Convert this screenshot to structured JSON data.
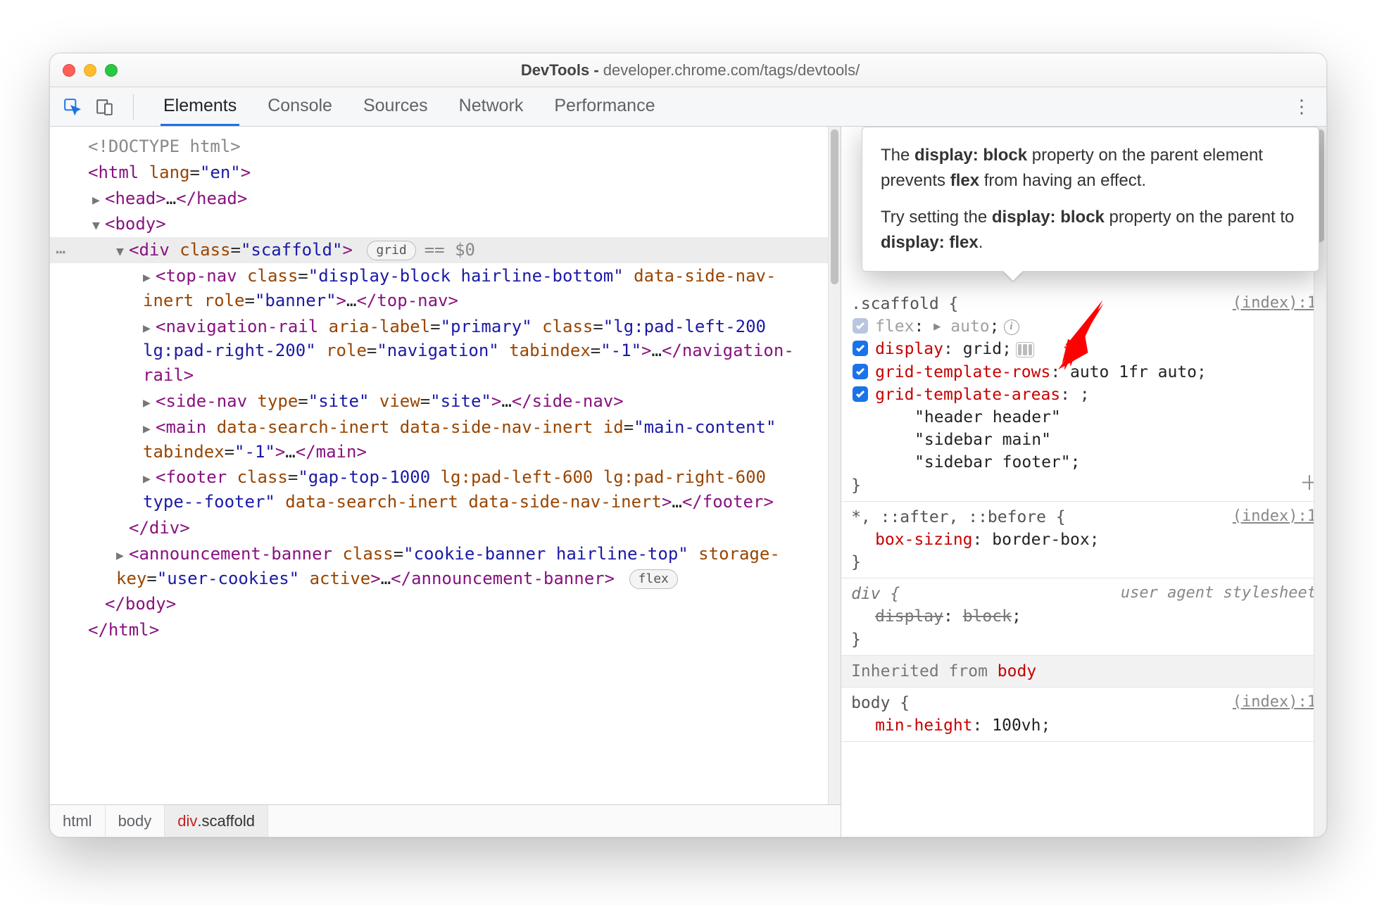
{
  "title_prefix": "DevTools - ",
  "title_url": "developer.chrome.com/tags/devtools/",
  "tabs": [
    "Elements",
    "Console",
    "Sources",
    "Network",
    "Performance"
  ],
  "tabs_active_index": 0,
  "dom": {
    "doctype": "<!DOCTYPE html>",
    "html_open": "<html lang=\"en\">",
    "head": "<head>…</head>",
    "body_open": "<body>",
    "scaffold_open": "<div class=\"scaffold\">",
    "scaffold_badge": "grid",
    "eq0": "== $0",
    "topnav": "<top-nav class=\"display-block hairline-bottom\" data-side-nav-inert role=\"banner\">…</top-nav>",
    "navrail": "<navigation-rail aria-label=\"primary\" class=\"lg:pad-left-200 lg:pad-right-200\" role=\"navigation\" tabindex=\"-1\">…</navigation-rail>",
    "sidenav": "<side-nav type=\"site\" view=\"site\">…</side-nav>",
    "main": "<main data-search-inert data-side-nav-inert id=\"main-content\" tabindex=\"-1\">…</main>",
    "footer": "<footer class=\"gap-top-1000 lg:pad-left-600 lg:pad-right-600 type--footer\" data-search-inert data-side-nav-inert>…</footer>",
    "div_close": "</div>",
    "announcement": "<announcement-banner class=\"cookie-banner hairline-top\" storage-key=\"user-cookies\" active>…</announcement-banner>",
    "announcement_badge": "flex",
    "body_close": "</body>",
    "html_close": "</html>"
  },
  "breadcrumbs": [
    {
      "label": "html",
      "active": false
    },
    {
      "label": "body",
      "active": false
    },
    {
      "label": "div.scaffold",
      "active": true
    }
  ],
  "tooltip": {
    "p1_pre": "The ",
    "p1_b1": "display: block",
    "p1_mid": " property on the parent element prevents ",
    "p1_b2": "flex",
    "p1_post": " from having an effect.",
    "p2_pre": "Try setting the ",
    "p2_b1": "display: block",
    "p2_mid": " property on the parent to ",
    "p2_b2": "display: flex",
    "p2_post": "."
  },
  "styles": {
    "rule1": {
      "selector": ".scaffold {",
      "source": "(index):1",
      "decls": [
        {
          "prop": "flex",
          "val": "auto",
          "checked": false,
          "inactive": true,
          "expand": true,
          "info": true
        },
        {
          "prop": "display",
          "val": "grid",
          "checked": true,
          "gridchip": true
        },
        {
          "prop": "grid-template-rows",
          "val": "auto 1fr auto",
          "checked": true
        },
        {
          "prop": "grid-template-areas",
          "val": "",
          "checked": true
        }
      ],
      "area_lines": [
        "\"header header\"",
        "\"sidebar main\"",
        "\"sidebar footer\""
      ],
      "close_brace": "}"
    },
    "rule2": {
      "selector": "*, ::after, ::before {",
      "source": "(index):1",
      "decls": [
        {
          "prop": "box-sizing",
          "val": "border-box"
        }
      ],
      "close_brace": "}"
    },
    "rule3": {
      "selector": "div {",
      "source": "user agent stylesheet",
      "decls": [
        {
          "prop": "display",
          "val": "block",
          "strike": true
        }
      ],
      "close_brace": "}",
      "italic": true
    },
    "inherited_label": "Inherited from ",
    "inherited_from": "body",
    "rule4": {
      "selector": "body {",
      "source": "(index):1",
      "decls": [
        {
          "prop": "min-height",
          "val": "100vh"
        }
      ]
    }
  }
}
